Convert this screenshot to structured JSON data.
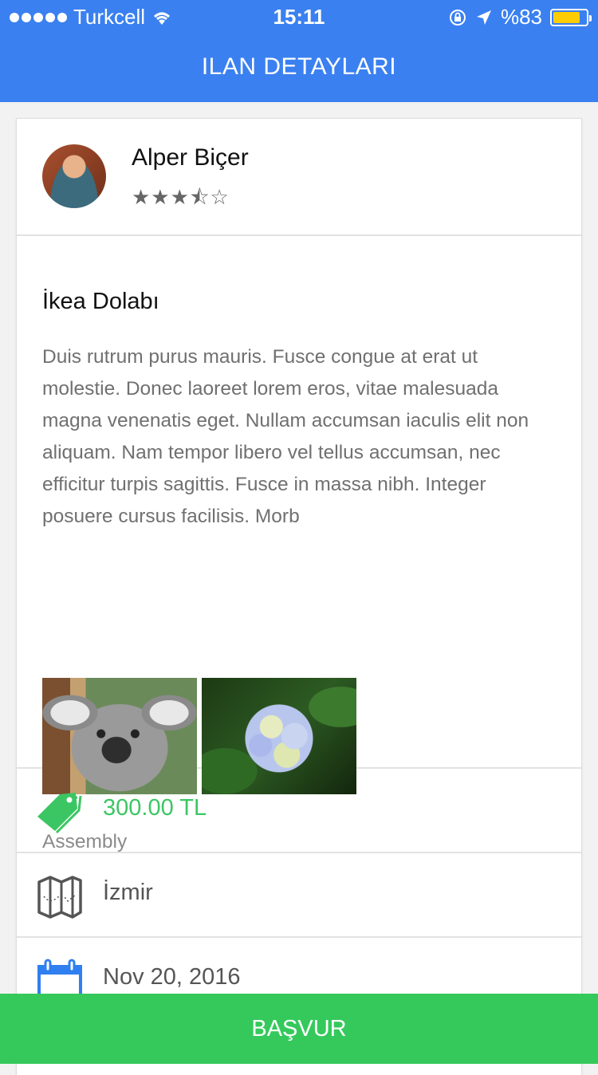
{
  "status_bar": {
    "carrier": "Turkcell",
    "time": "15:11",
    "battery": "%83",
    "battery_level": 0.83
  },
  "navbar": {
    "title": "ILAN DETAYLARI"
  },
  "user": {
    "name": "Alper Biçer",
    "rating": 3.5,
    "rating_max": 5,
    "rating_stars": "★★★⯪☆"
  },
  "listing": {
    "title": "İkea Dolabı",
    "description": "Duis rutrum purus mauris. Fusce congue at erat ut molestie. Donec laoreet lorem eros, vitae malesuada magna venenatis eget. Nullam accumsan iaculis elit non aliquam. Nam tempor libero vel tellus accumsan, nec efficitur turpis sagittis. Fusce in massa nibh. Integer posuere cursus facilisis. Morb",
    "photos": [
      "koala-photo",
      "flower-photo"
    ],
    "category": "Assembly"
  },
  "details": {
    "price": "300.00 TL",
    "location": "İzmir",
    "date": "Nov 20, 2016"
  },
  "icons": {
    "price": "price-tag-icon",
    "location": "map-icon",
    "date": "calendar-icon"
  },
  "colors": {
    "primary": "#3a80f0",
    "accent_green": "#35c95c",
    "calendar_blue": "#2f7ff0"
  },
  "actions": {
    "apply_label": "BAŞVUR"
  }
}
